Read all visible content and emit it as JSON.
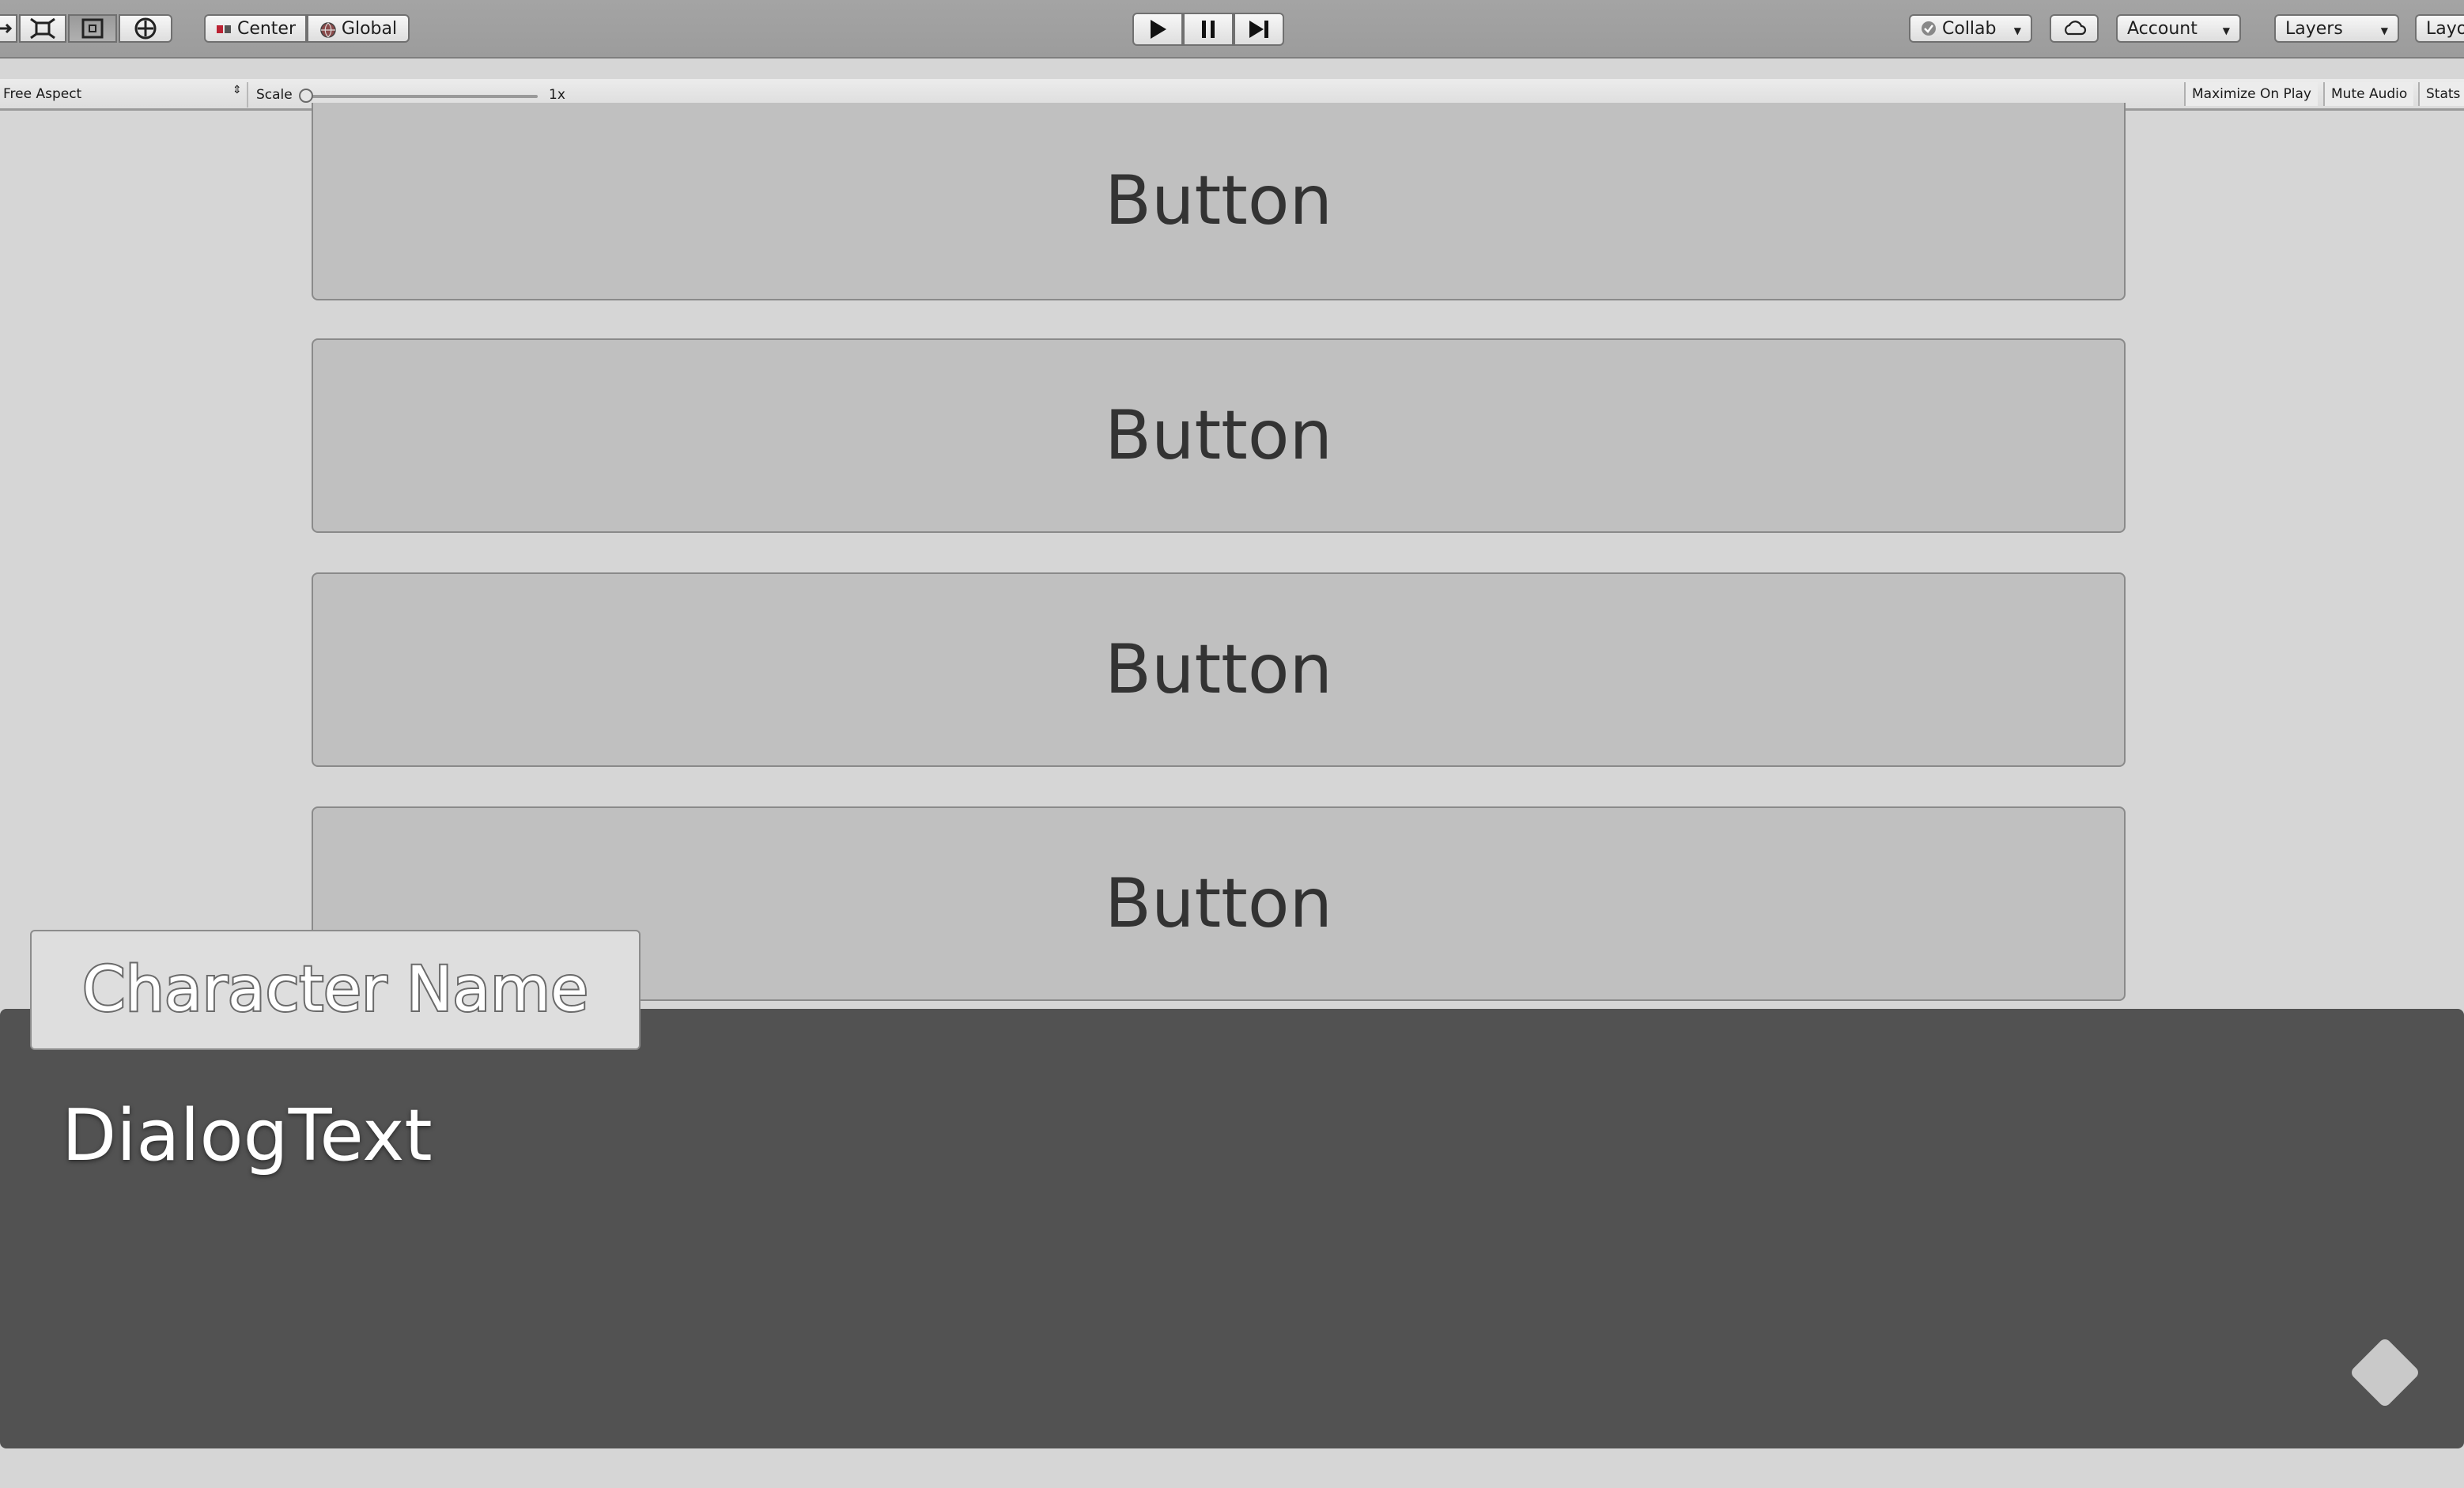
{
  "toolbar": {
    "tools": [
      "hand-tool",
      "rect-transform-tool",
      "rect-tool",
      "transform-tool"
    ],
    "pivot": {
      "center_label": "Center",
      "global_label": "Global"
    },
    "play_controls": [
      "play",
      "pause",
      "step"
    ],
    "collab_label": "Collab",
    "account_label": "Account",
    "layers_label": "Layers",
    "layout_label": "Layo"
  },
  "viewbar": {
    "aspect_label": "Free Aspect",
    "scale_label": "Scale",
    "scale_value": "1x",
    "maximize_label": "Maximize On Play",
    "mute_label": "Mute Audio",
    "stats_label": "Stats"
  },
  "game": {
    "choices": [
      "Button",
      "Button",
      "Button",
      "Button"
    ],
    "character_name": "Character Name",
    "dialog_text": "DialogText",
    "continue_icon": "diamond-indicator"
  },
  "colors": {
    "dialog_panel": "#525252",
    "choice_button": "#c0c0c0",
    "toolbar": "#a0a0a0"
  }
}
